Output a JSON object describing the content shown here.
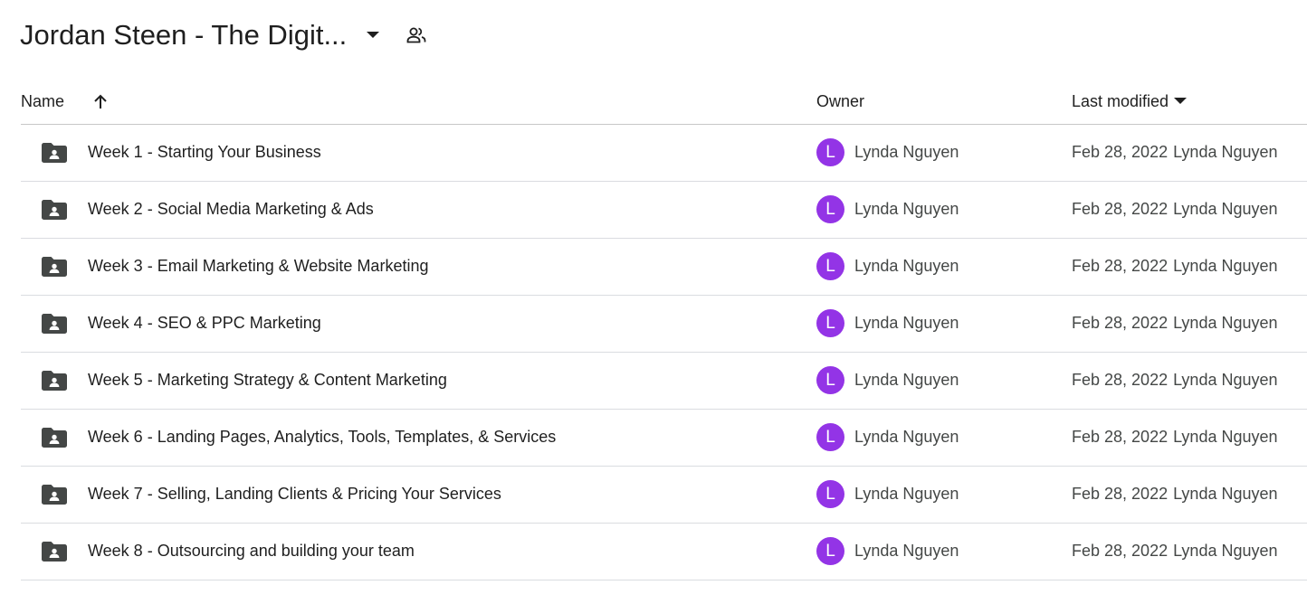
{
  "header": {
    "folder_title": "Jordan Steen - The Digit...",
    "dropdown_icon": "arrow-drop-down-icon",
    "shared_icon": "shared-people-icon"
  },
  "table": {
    "columns": {
      "name": "Name",
      "owner": "Owner",
      "last_modified": "Last modified"
    },
    "sort": {
      "column": "Name",
      "direction": "ascending",
      "icon": "arrow-up-icon"
    },
    "accent_colors": {
      "avatar": "#9334e6",
      "folder_icon": "#444746"
    },
    "rows": [
      {
        "name": "Week 1 - Starting Your Business",
        "owner_initial": "L",
        "owner": "Lynda Nguyen",
        "date": "Feb 28, 2022",
        "modified_by": "Lynda Nguyen"
      },
      {
        "name": "Week 2 - Social Media Marketing & Ads",
        "owner_initial": "L",
        "owner": "Lynda Nguyen",
        "date": "Feb 28, 2022",
        "modified_by": "Lynda Nguyen"
      },
      {
        "name": "Week 3 - Email Marketing & Website Marketing",
        "owner_initial": "L",
        "owner": "Lynda Nguyen",
        "date": "Feb 28, 2022",
        "modified_by": "Lynda Nguyen"
      },
      {
        "name": "Week 4 - SEO & PPC Marketing",
        "owner_initial": "L",
        "owner": "Lynda Nguyen",
        "date": "Feb 28, 2022",
        "modified_by": "Lynda Nguyen"
      },
      {
        "name": "Week 5 - Marketing Strategy & Content Marketing",
        "owner_initial": "L",
        "owner": "Lynda Nguyen",
        "date": "Feb 28, 2022",
        "modified_by": "Lynda Nguyen"
      },
      {
        "name": "Week 6 - Landing Pages, Analytics, Tools, Templates, & Services",
        "owner_initial": "L",
        "owner": "Lynda Nguyen",
        "date": "Feb 28, 2022",
        "modified_by": "Lynda Nguyen"
      },
      {
        "name": "Week 7 - Selling, Landing Clients & Pricing Your Services",
        "owner_initial": "L",
        "owner": "Lynda Nguyen",
        "date": "Feb 28, 2022",
        "modified_by": "Lynda Nguyen"
      },
      {
        "name": "Week 8 - Outsourcing and building your team",
        "owner_initial": "L",
        "owner": "Lynda Nguyen",
        "date": "Feb 28, 2022",
        "modified_by": "Lynda Nguyen"
      }
    ]
  }
}
